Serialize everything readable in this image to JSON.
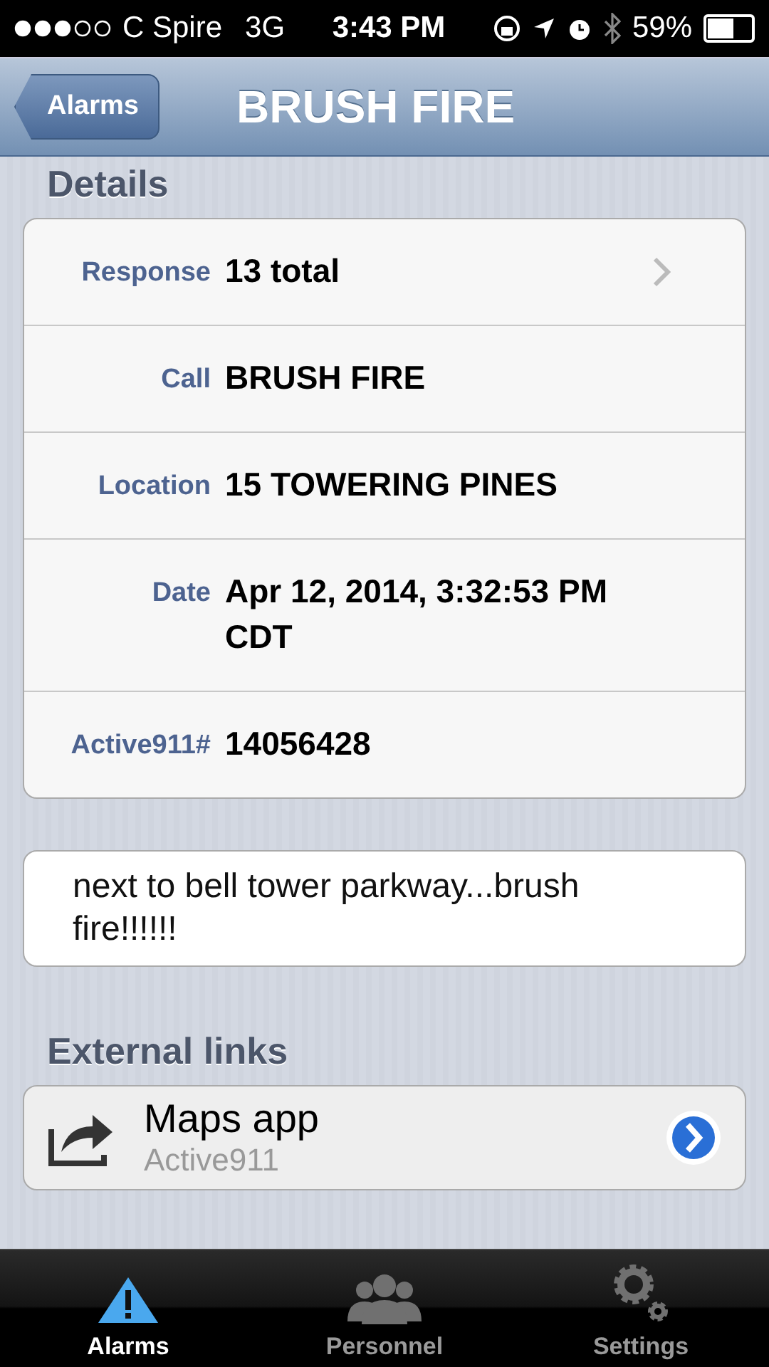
{
  "status_bar": {
    "carrier": "C Spire",
    "network": "3G",
    "time": "3:43 PM",
    "battery": "59%"
  },
  "nav": {
    "back": "Alarms",
    "title": "BRUSH FIRE"
  },
  "details": {
    "heading": "Details",
    "rows": [
      {
        "label": "Response",
        "value": "13 total",
        "disclosure": true
      },
      {
        "label": "Call",
        "value": "BRUSH FIRE",
        "disclosure": false
      },
      {
        "label": "Location",
        "value": "15 TOWERING PINES",
        "disclosure": false
      },
      {
        "label": "Date",
        "value": "Apr 12, 2014, 3:32:53 PM CDT",
        "disclosure": false
      },
      {
        "label": "Active911#",
        "value": "14056428",
        "disclosure": false
      }
    ]
  },
  "note": "next to bell tower parkway...brush fire!!!!!!",
  "external_links": {
    "heading": "External links",
    "items": [
      {
        "title": "Maps app",
        "subtitle": "Active911"
      }
    ]
  },
  "tabs": [
    {
      "label": "Alarms",
      "kind": "alert",
      "selected": true
    },
    {
      "label": "Personnel",
      "kind": "people",
      "selected": false
    },
    {
      "label": "Settings",
      "kind": "gears",
      "selected": false
    }
  ]
}
